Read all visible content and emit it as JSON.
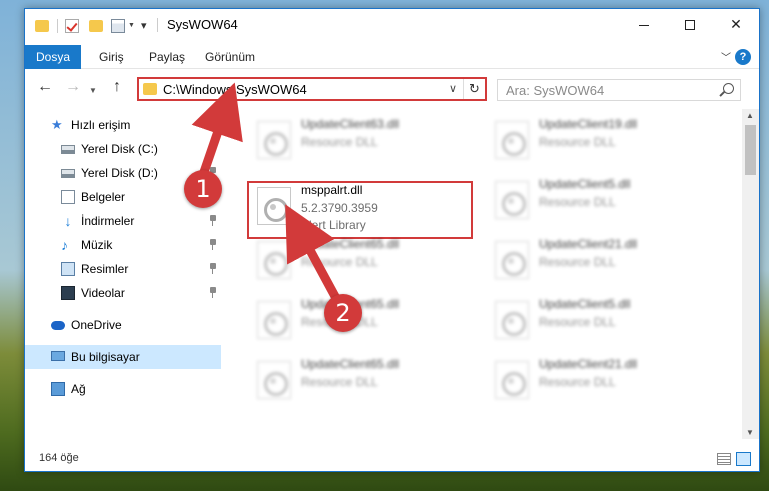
{
  "window": {
    "title": "SysWOW64",
    "controls": {
      "minimize": "",
      "maximize": "",
      "close": "✕"
    }
  },
  "ribbon": {
    "tabs": [
      "Dosya",
      "Giriş",
      "Paylaş",
      "Görünüm"
    ],
    "help": "?"
  },
  "navigation": {
    "address": "C:\\Windows\\SysWOW64",
    "search_placeholder": "Ara: SysWOW64"
  },
  "sidebar": {
    "items": [
      {
        "label": "Hızlı erişim",
        "icon": "star-icon"
      },
      {
        "label": "Yerel Disk (C:)",
        "icon": "disk-icon"
      },
      {
        "label": "Yerel Disk (D:)",
        "icon": "disk-icon"
      },
      {
        "label": "Belgeler",
        "icon": "documents-icon"
      },
      {
        "label": "İndirmeler",
        "icon": "download-icon"
      },
      {
        "label": "Müzik",
        "icon": "music-icon"
      },
      {
        "label": "Resimler",
        "icon": "pictures-icon"
      },
      {
        "label": "Videolar",
        "icon": "videos-icon"
      },
      {
        "label": "OneDrive",
        "icon": "cloud-icon"
      },
      {
        "label": "Bu bilgisayar",
        "icon": "computer-icon"
      },
      {
        "label": "Ağ",
        "icon": "network-icon"
      }
    ]
  },
  "files": [
    {
      "name": "UpdateClient63.dll",
      "type": "Resource DLL",
      "version": ""
    },
    {
      "name": "UpdateClient19.dll",
      "type": "Resource DLL",
      "version": ""
    },
    {
      "name": "msppalrt.dll",
      "version": "5.2.3790.3959",
      "type": "Alert Library"
    },
    {
      "name": "UpdateClient5.dll",
      "type": "Resource DLL",
      "version": ""
    },
    {
      "name": "UpdateClient65.dll",
      "type": "Resource DLL",
      "version": ""
    },
    {
      "name": "UpdateClient21.dll",
      "type": "Resource DLL",
      "version": ""
    },
    {
      "name": "UpdateClient65.dll",
      "type": "Resource DLL",
      "version": ""
    },
    {
      "name": "UpdateClient5.dll",
      "type": "Resource DLL",
      "version": ""
    },
    {
      "name": "UpdateClient65.dll",
      "type": "Resource DLL",
      "version": ""
    },
    {
      "name": "UpdateClient21.dll",
      "type": "Resource DLL",
      "version": ""
    }
  ],
  "status": {
    "count": "164 öğe"
  },
  "annotations": {
    "badge1": "1",
    "badge2": "2"
  },
  "colors": {
    "accent": "#1979ca",
    "highlight": "#d23a3a",
    "selected": "#cce8ff"
  }
}
